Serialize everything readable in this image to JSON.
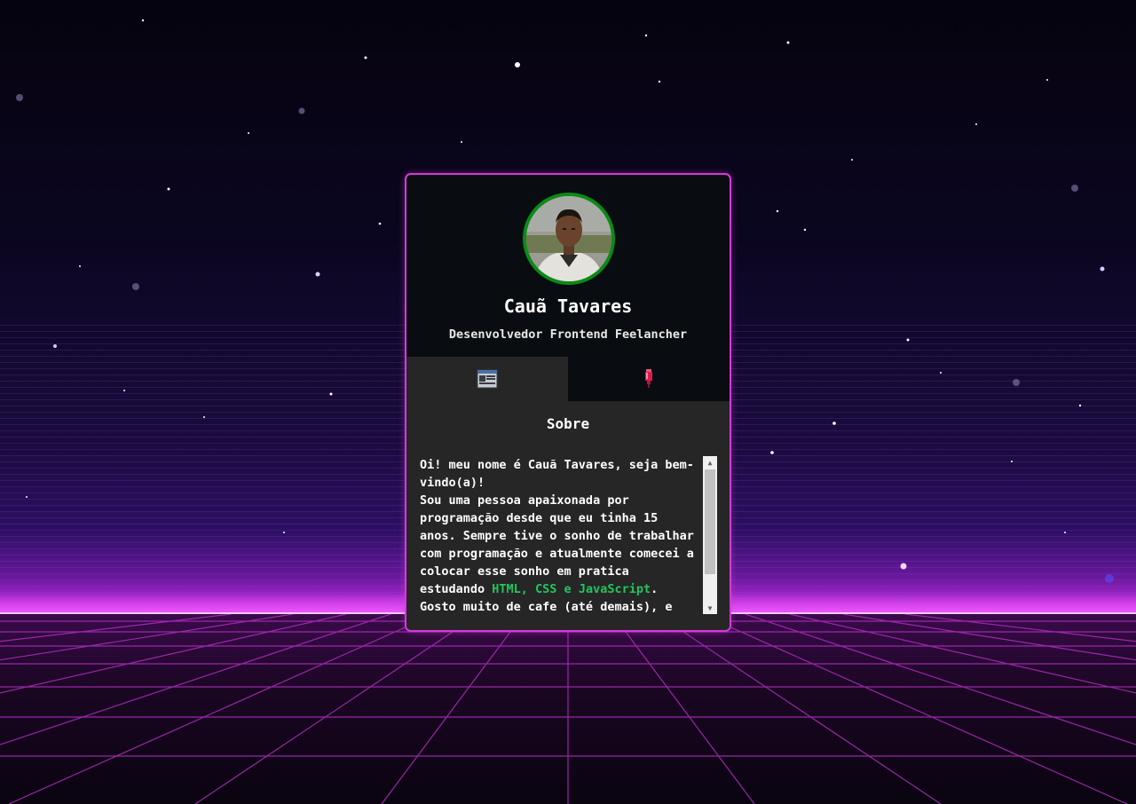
{
  "profile": {
    "name": "Cauã Tavares",
    "role": "Desenvolvedor Frontend Feelancher"
  },
  "tabs": [
    {
      "icon": "window-panel-icon",
      "active": true
    },
    {
      "icon": "red-marker-icon",
      "active": false
    }
  ],
  "panel": {
    "title": "Sobre",
    "text_part1": "Oi! meu nome é Cauã Tavares, seja bem-vindo(a)!\nSou uma pessoa apaixonada por programação desde que eu tinha 15 anos. Sempre tive o sonho de trabalhar com programação e atualmente comecei a colocar esse sonho em pratica estudando ",
    "text_highlight": "HTML, CSS e JavaScript",
    "text_part2": ".\nGosto muito de cafe (até demais), e",
    "highlight_color": "#22c55e"
  },
  "colors": {
    "card_border": "#d33bd6",
    "avatar_border": "#0b8a16",
    "panel_bg": "#262626",
    "card_bg": "#090c10"
  }
}
